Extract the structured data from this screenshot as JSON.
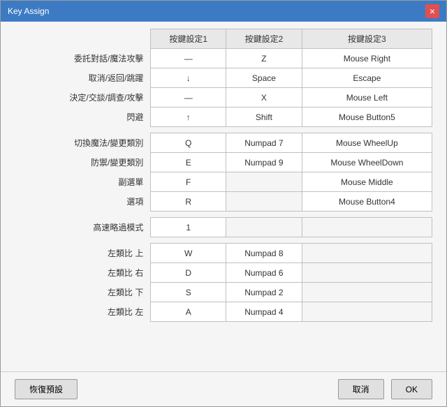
{
  "window": {
    "title": "Key Assign",
    "close_label": "×"
  },
  "table": {
    "headers": [
      "",
      "按鍵設定1",
      "按鍵設定2",
      "按鍵設定3"
    ],
    "rows": [
      {
        "label": "委託對話/魔法攻擊",
        "col1": "—",
        "col2": "Z",
        "col3": "Mouse Right"
      },
      {
        "label": "取消/返回/跳躍",
        "col1": "↓",
        "col2": "Space",
        "col3": "Escape"
      },
      {
        "label": "決定/交談/調查/攻擊",
        "col1": "—",
        "col2": "X",
        "col3": "Mouse Left"
      },
      {
        "label": "閃避",
        "col1": "↑",
        "col2": "Shift",
        "col3": "Mouse Button5"
      },
      {
        "label": "切換魔法/變更類別",
        "col1": "Q",
        "col2": "Numpad 7",
        "col3": "Mouse WheelUp"
      },
      {
        "label": "防禦/變更類別",
        "col1": "E",
        "col2": "Numpad 9",
        "col3": "Mouse WheelDown"
      },
      {
        "label": "副選單",
        "col1": "F",
        "col2": "",
        "col3": "Mouse Middle"
      },
      {
        "label": "選項",
        "col1": "R",
        "col2": "",
        "col3": "Mouse Button4"
      },
      {
        "label": "高速略過模式",
        "col1": "1",
        "col2": "",
        "col3": ""
      },
      {
        "label": "左類比 上",
        "col1": "W",
        "col2": "Numpad 8",
        "col3": ""
      },
      {
        "label": "左類比 右",
        "col1": "D",
        "col2": "Numpad 6",
        "col3": ""
      },
      {
        "label": "左類比 下",
        "col1": "S",
        "col2": "Numpad 2",
        "col3": ""
      },
      {
        "label": "左類比 左",
        "col1": "A",
        "col2": "Numpad 4",
        "col3": ""
      }
    ]
  },
  "footer": {
    "restore_label": "恢復預設",
    "cancel_label": "取消",
    "ok_label": "OK"
  }
}
